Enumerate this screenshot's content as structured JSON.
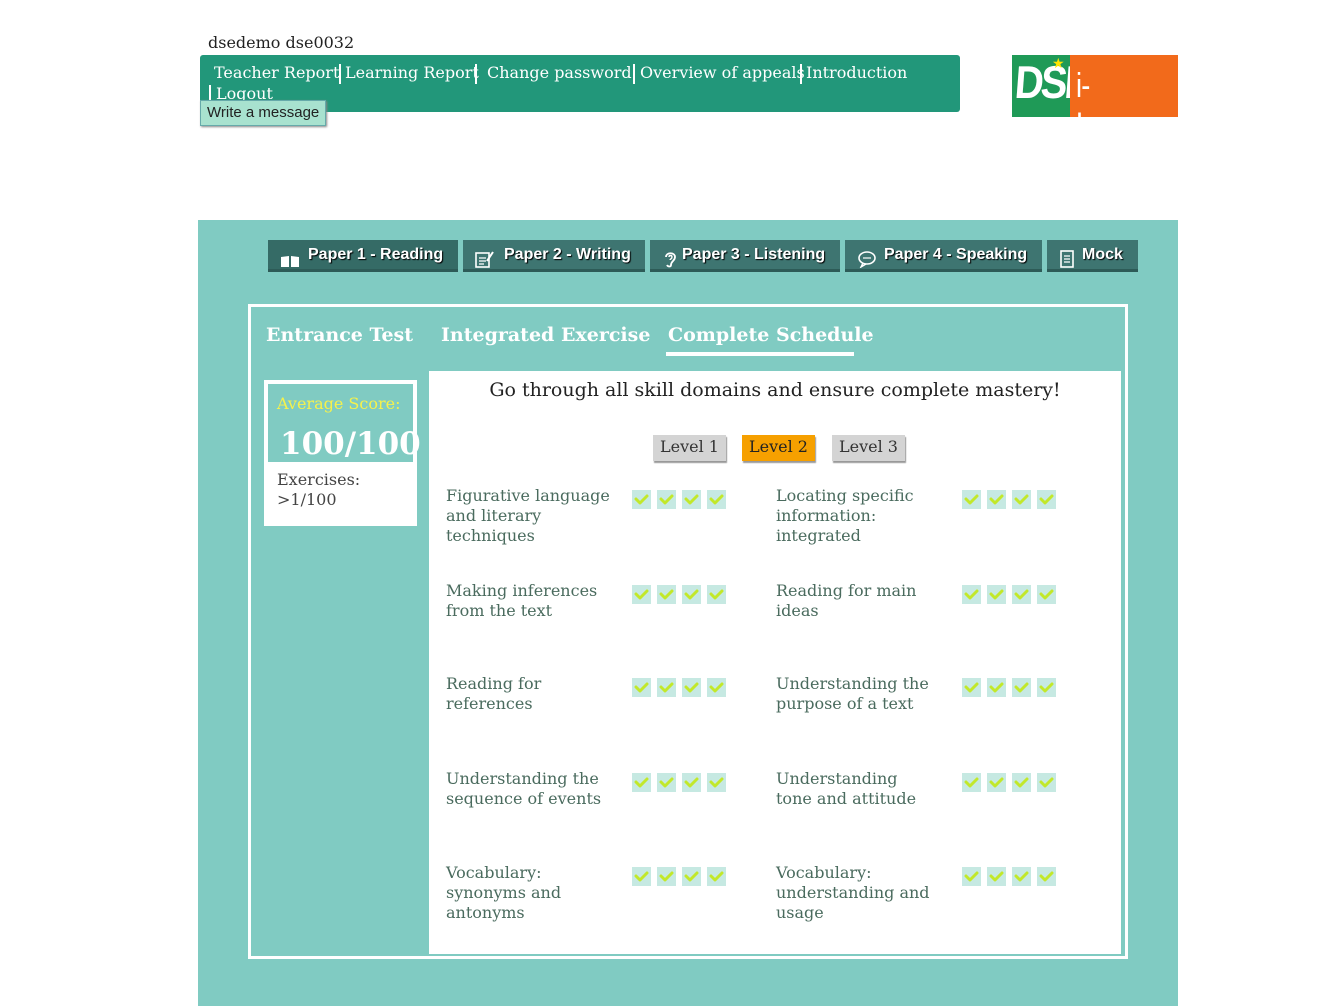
{
  "user": {
    "name": "dsedemo dse0032"
  },
  "nav": {
    "items": [
      {
        "label": "Teacher Report"
      },
      {
        "label": "Learning Report"
      },
      {
        "label": "Change password"
      },
      {
        "label": "Overview of appeals"
      },
      {
        "label": "Introduction"
      },
      {
        "label": "Logout"
      }
    ],
    "write_message": "Write a message"
  },
  "logo": {
    "left_text": "DSE",
    "right_text": "i-Learner"
  },
  "paper_tabs": [
    {
      "label": "Paper 1 - Reading",
      "icon": "book-icon",
      "active": true
    },
    {
      "label": "Paper 2 - Writing",
      "icon": "notepad-pencil-icon"
    },
    {
      "label": "Paper 3 - Listening",
      "icon": "ear-icon"
    },
    {
      "label": "Paper 4 - Speaking",
      "icon": "speech-bubble-icon"
    },
    {
      "label": "Mock",
      "icon": "document-icon"
    }
  ],
  "sub_tabs": [
    {
      "label": "Entrance Test"
    },
    {
      "label": "Integrated Exercise"
    },
    {
      "label": "Complete Schedule",
      "active": true
    }
  ],
  "score": {
    "avg_label": "Average Score:",
    "value": "100/100",
    "exercises_label": "Exercises:",
    "exercises_value": ">1/100"
  },
  "headline": "Go through all skill domains and ensure complete mastery!",
  "levels": [
    {
      "label": "Level 1"
    },
    {
      "label": "Level 2",
      "active": true
    },
    {
      "label": "Level 3"
    }
  ],
  "skills": [
    {
      "name": "Figurative language and literary techniques",
      "checks": 4
    },
    {
      "name": "Locating specific information: integrated",
      "checks": 4
    },
    {
      "name": "Making inferences from the text",
      "checks": 4
    },
    {
      "name": "Reading for main ideas",
      "checks": 4
    },
    {
      "name": "Reading for references",
      "checks": 4
    },
    {
      "name": "Understanding the purpose of a text",
      "checks": 4
    },
    {
      "name": "Understanding the sequence of events",
      "checks": 4
    },
    {
      "name": "Understanding tone and attitude",
      "checks": 4
    },
    {
      "name": "Vocabulary: synonyms and antonyms",
      "checks": 4
    },
    {
      "name": "Vocabulary: understanding and usage",
      "checks": 4
    }
  ],
  "colors": {
    "nav_green": "#22977a",
    "panel_teal": "#80cbc2",
    "tab_dark": "#356b66",
    "level_active": "#f6a000",
    "score_yellow": "#f6f24b",
    "check_green": "#c2e82a"
  }
}
